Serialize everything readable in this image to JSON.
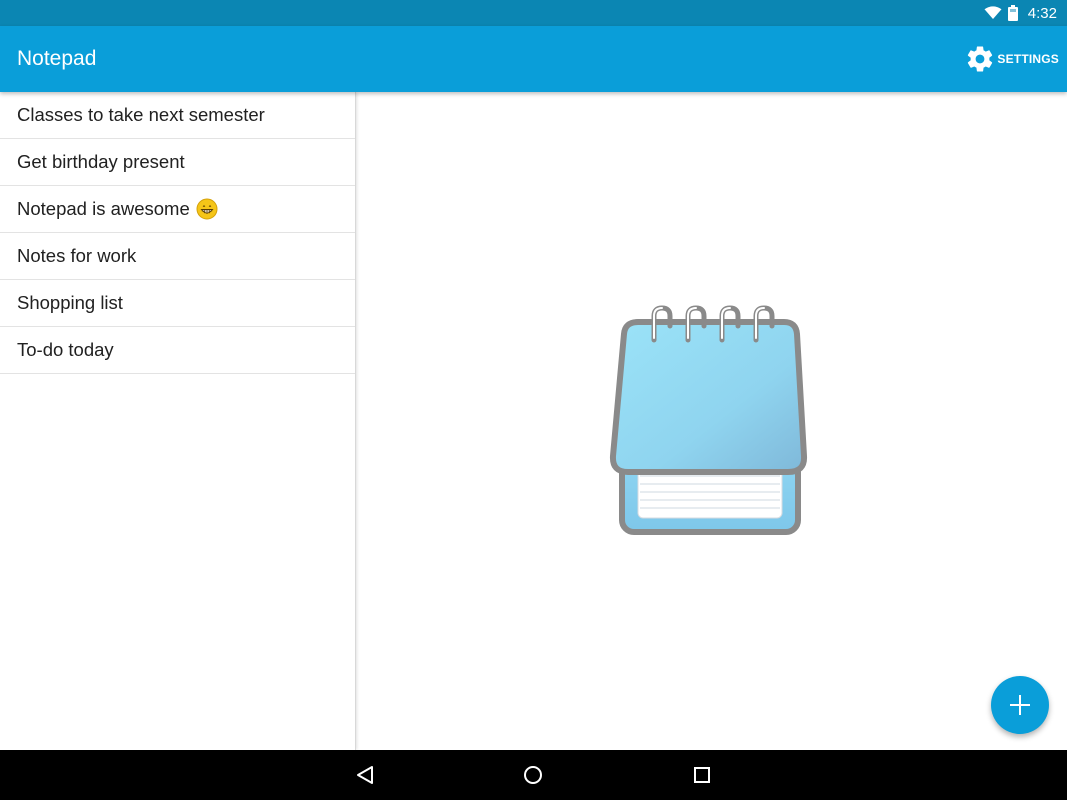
{
  "status_bar": {
    "time": "4:32",
    "icons": [
      "wifi-icon",
      "battery-icon"
    ]
  },
  "app_bar": {
    "title": "Notepad",
    "settings_label": "SETTINGS",
    "settings_icon": "gear-icon"
  },
  "notes": [
    {
      "title": "Classes to take next semester"
    },
    {
      "title": "Get birthday present"
    },
    {
      "title": "Notepad is awesome",
      "emoji": "grinning-face-icon"
    },
    {
      "title": "Notes for work"
    },
    {
      "title": "Shopping list"
    },
    {
      "title": "To-do today"
    }
  ],
  "detail": {
    "illustration": "notepad-icon"
  },
  "fab": {
    "icon": "plus-icon"
  },
  "nav_bar": {
    "icons": [
      "back-icon",
      "home-icon",
      "recents-icon"
    ]
  },
  "colors": {
    "status_bar": "#0b86b3",
    "app_bar": "#0a9ed9",
    "accent": "#0a9ed9",
    "text_primary": "#212121",
    "nav_bar": "#000000"
  }
}
